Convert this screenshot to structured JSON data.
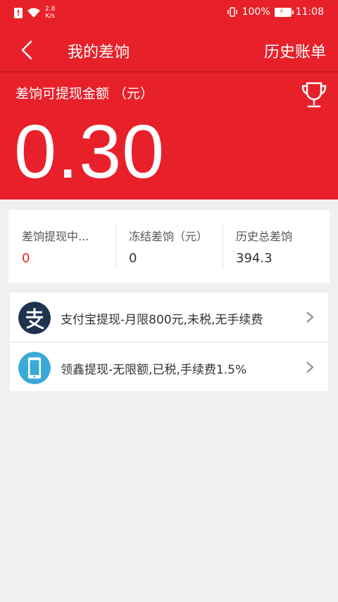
{
  "status_bar": {
    "net_speed_value": "2.8",
    "net_speed_unit": "K/s",
    "battery": "100%",
    "time": "11:08"
  },
  "navbar": {
    "title": "我的差饷",
    "history_link": "历史账单"
  },
  "balance": {
    "label": "差饷可提现金额 （元）",
    "amount": "0.30"
  },
  "stats": [
    {
      "label": "差饷提现中...",
      "value": "0",
      "value_color": "#e8202a"
    },
    {
      "label": "冻结差饷（元）",
      "value": "0",
      "value_color": "#333333"
    },
    {
      "label": "历史总差饷",
      "value": "394.3",
      "value_color": "#333333"
    }
  ],
  "withdraw_methods": [
    {
      "icon": "alipay-icon",
      "label": "支付宝提现-月限800元,未税,无手续费"
    },
    {
      "icon": "phone-icon",
      "label": "领鑫提现-无限额,已税,手续费1.5%"
    }
  ],
  "colors": {
    "brand_red": "#e8202a",
    "alipay_dark": "#1f3350",
    "phone_blue": "#3aaad8"
  }
}
